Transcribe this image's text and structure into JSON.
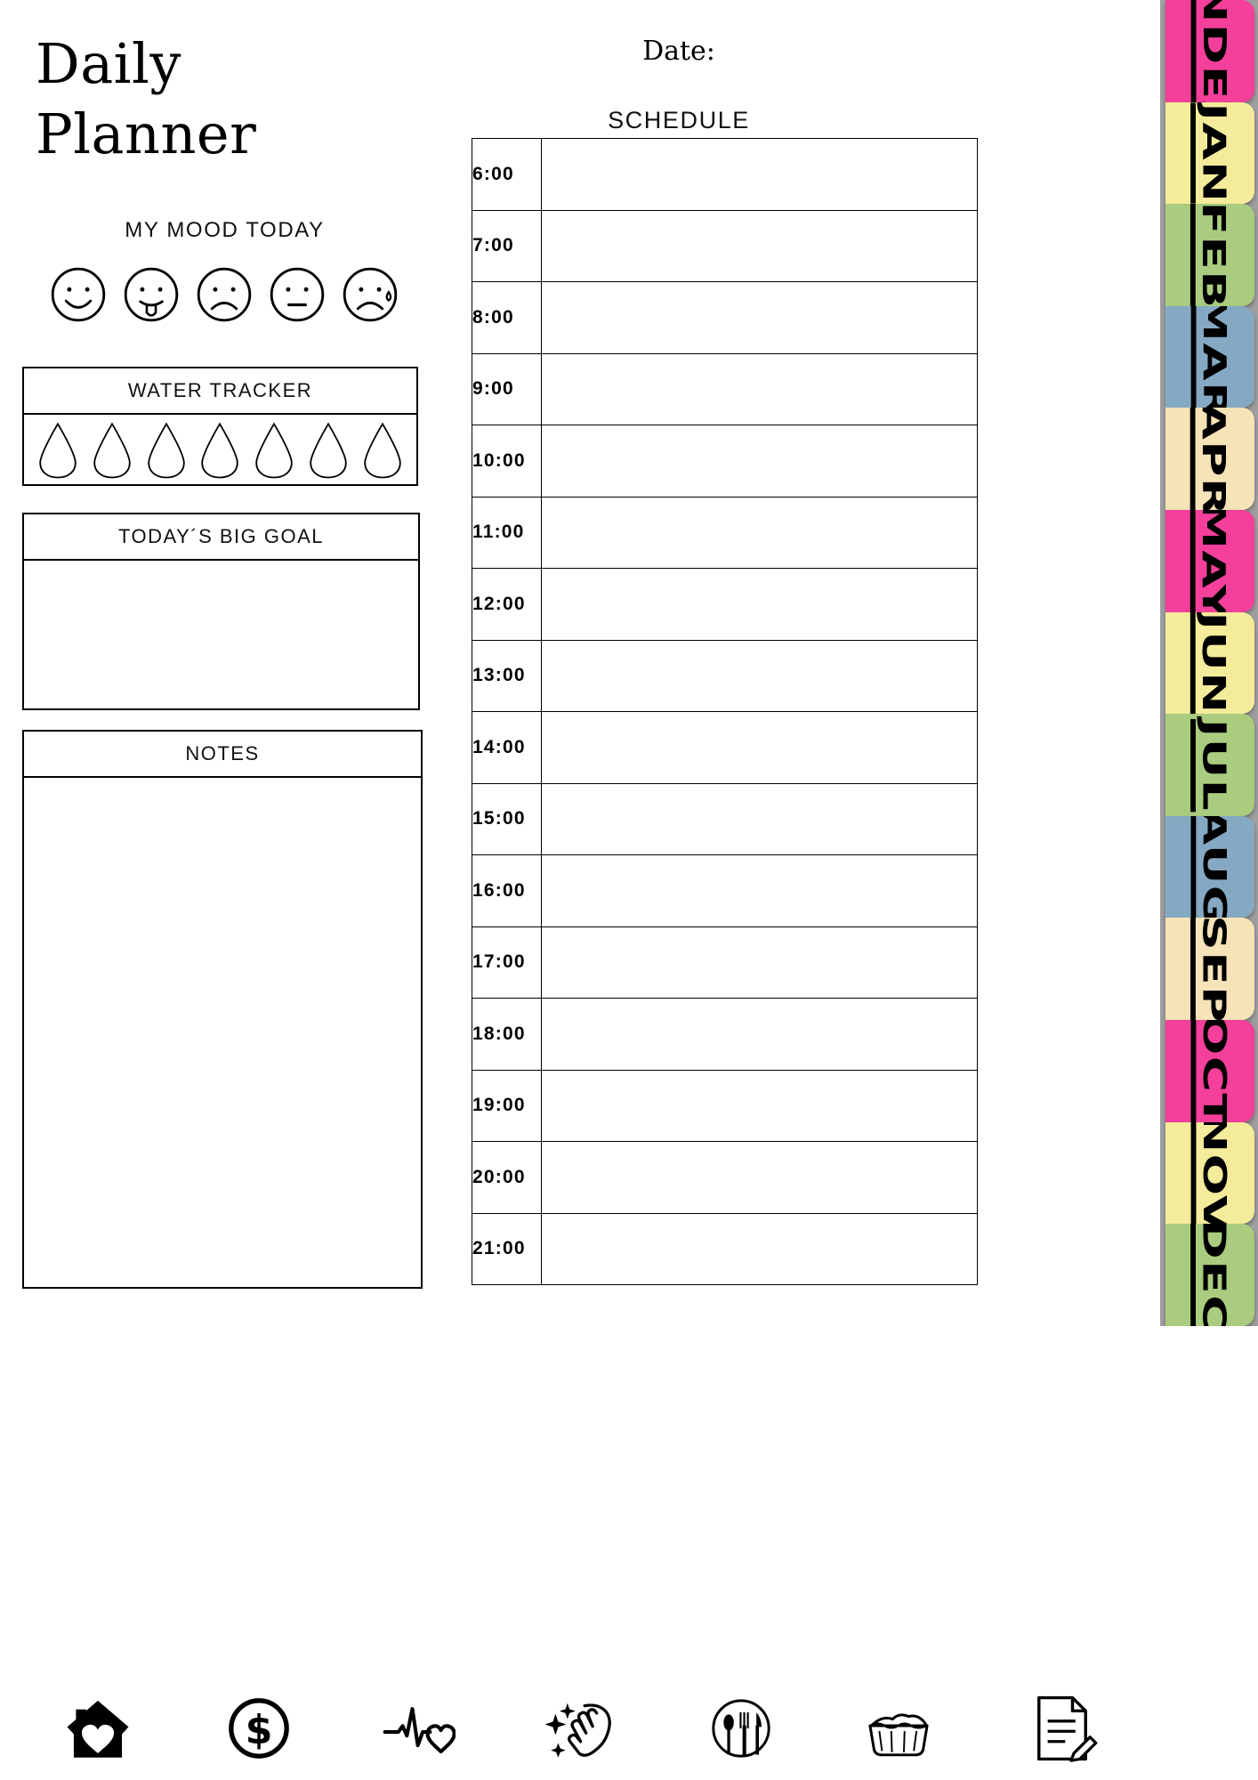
{
  "title": "Daily\nPlanner",
  "header": {
    "date_label": "Date:",
    "schedule_label": "SCHEDULE"
  },
  "mood": {
    "caption": "MY MOOD TODAY",
    "faces": [
      {
        "name": "happy-face",
        "icon": "smiley-happy"
      },
      {
        "name": "playful-face",
        "icon": "smiley-tongue"
      },
      {
        "name": "sad-face",
        "icon": "smiley-sad"
      },
      {
        "name": "neutral-face",
        "icon": "smiley-neutral"
      },
      {
        "name": "crying-face",
        "icon": "smiley-crying"
      }
    ]
  },
  "water_tracker": {
    "title": "WATER TRACKER",
    "drop_count": 7,
    "drop_icon": "water-drop-icon"
  },
  "big_goal": {
    "title": "TODAY´S BIG GOAL",
    "value": ""
  },
  "notes": {
    "title": "NOTES",
    "value": ""
  },
  "schedule": {
    "rows": [
      {
        "time": "6:00",
        "entry": ""
      },
      {
        "time": "7:00",
        "entry": ""
      },
      {
        "time": "8:00",
        "entry": ""
      },
      {
        "time": "9:00",
        "entry": ""
      },
      {
        "time": "10:00",
        "entry": ""
      },
      {
        "time": "11:00",
        "entry": ""
      },
      {
        "time": "12:00",
        "entry": ""
      },
      {
        "time": "13:00",
        "entry": ""
      },
      {
        "time": "14:00",
        "entry": ""
      },
      {
        "time": "15:00",
        "entry": ""
      },
      {
        "time": "16:00",
        "entry": ""
      },
      {
        "time": "17:00",
        "entry": ""
      },
      {
        "time": "18:00",
        "entry": ""
      },
      {
        "time": "19:00",
        "entry": ""
      },
      {
        "time": "20:00",
        "entry": ""
      },
      {
        "time": "21:00",
        "entry": ""
      }
    ]
  },
  "tabs": {
    "colors": {
      "pink": "#F43F9B",
      "yellow": "#F5EC9B",
      "green": "#A9CC7E",
      "blue": "#85A9C3",
      "cream": "#F6E3B8",
      "rail_background": "#9E9E9E"
    },
    "items": [
      {
        "label": "INDEX",
        "color": "#F43F9B"
      },
      {
        "label": "JAN",
        "color": "#F5EC9B"
      },
      {
        "label": "FEB",
        "color": "#A9CC7E"
      },
      {
        "label": "MAR",
        "color": "#85A9C3"
      },
      {
        "label": "APR",
        "color": "#F6E3B8"
      },
      {
        "label": "MAY",
        "color": "#F43F9B"
      },
      {
        "label": "JUN",
        "color": "#F5EC9B"
      },
      {
        "label": "JUL",
        "color": "#A9CC7E"
      },
      {
        "label": "AUG",
        "color": "#85A9C3"
      },
      {
        "label": "SEP",
        "color": "#F6E3B8"
      },
      {
        "label": "OCT",
        "color": "#F43F9B"
      },
      {
        "label": "NOV",
        "color": "#F5EC9B"
      },
      {
        "label": "DEC",
        "color": "#A9CC7E"
      }
    ]
  },
  "bottom_icons": [
    {
      "name": "home-heart-icon"
    },
    {
      "name": "money-dollar-icon"
    },
    {
      "name": "health-heartbeat-icon"
    },
    {
      "name": "cleaning-hand-icon"
    },
    {
      "name": "meals-plate-icon"
    },
    {
      "name": "laundry-basket-icon"
    },
    {
      "name": "notes-document-icon"
    }
  ]
}
